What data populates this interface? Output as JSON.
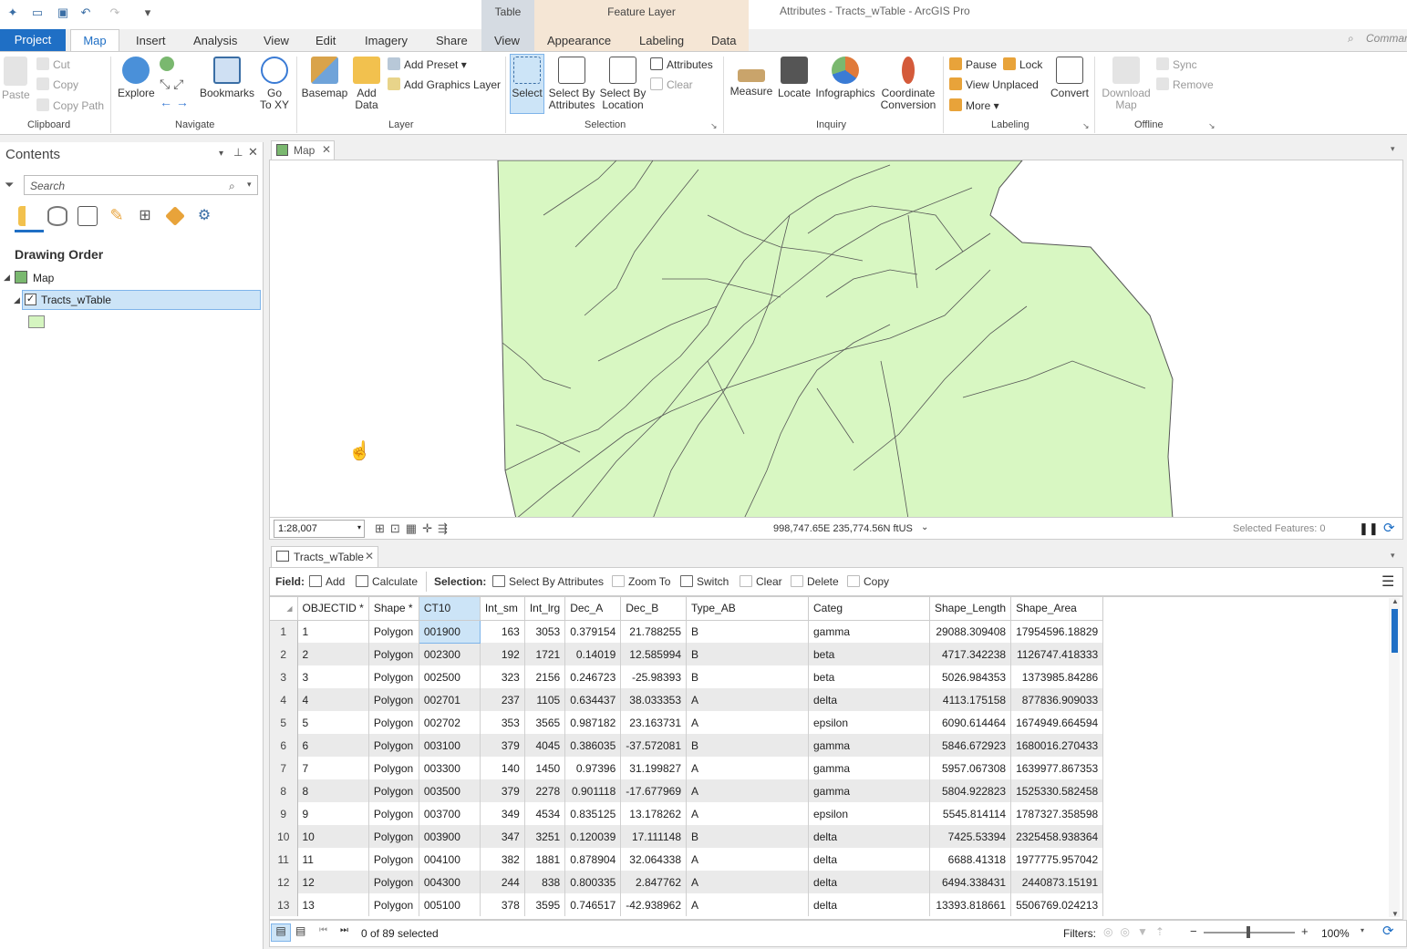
{
  "app": {
    "title": "Attributes - Tracts_wTable - ArcGIS Pro",
    "context_tabs": {
      "table": "Table",
      "feature_layer": "Feature Layer"
    },
    "command_search": "Command"
  },
  "tabs": [
    "Project",
    "Map",
    "Insert",
    "Analysis",
    "View",
    "Edit",
    "Imagery",
    "Share",
    "View",
    "Appearance",
    "Labeling",
    "Data"
  ],
  "ribbon": {
    "clipboard": {
      "label": "Clipboard",
      "paste": "Paste",
      "cut": "Cut",
      "copy": "Copy",
      "copy_path": "Copy Path"
    },
    "navigate": {
      "label": "Navigate",
      "explore": "Explore",
      "bookmarks": "Bookmarks",
      "goto_1": "Go",
      "goto_2": "To XY"
    },
    "layer": {
      "label": "Layer",
      "basemap": "Basemap",
      "add_data_1": "Add",
      "add_data_2": "Data",
      "add_preset": "Add Preset",
      "add_graphics": "Add Graphics Layer"
    },
    "selection": {
      "label": "Selection",
      "select": "Select",
      "sba_1": "Select By",
      "sba_2": "Attributes",
      "sbl_1": "Select By",
      "sbl_2": "Location",
      "attributes": "Attributes",
      "clear": "Clear"
    },
    "inquiry": {
      "label": "Inquiry",
      "measure": "Measure",
      "locate": "Locate",
      "infographics": "Infographics",
      "cc_1": "Coordinate",
      "cc_2": "Conversion"
    },
    "labeling": {
      "label": "Labeling",
      "pause": "Pause",
      "lock": "Lock",
      "view_unplaced": "View Unplaced",
      "more": "More",
      "convert": "Convert"
    },
    "offline": {
      "label": "Offline",
      "download_1": "Download",
      "download_2": "Map",
      "sync": "Sync",
      "remove": "Remove"
    }
  },
  "contents": {
    "title": "Contents",
    "search_placeholder": "Search",
    "drawing_order": "Drawing Order",
    "map_node": "Map",
    "layer_node": "Tracts_wTable"
  },
  "map": {
    "tab": "Map",
    "scale": "1:28,007",
    "coords": "998,747.65E 235,774.56N ftUS",
    "selected_features": "Selected Features: 0",
    "fill_color": "#d8f7c2"
  },
  "table": {
    "tab": "Tracts_wTable",
    "toolbar": {
      "field_label": "Field:",
      "add": "Add",
      "calculate": "Calculate",
      "selection_label": "Selection:",
      "select_by_attributes": "Select By Attributes",
      "zoom_to": "Zoom To",
      "switch": "Switch",
      "clear": "Clear",
      "delete": "Delete",
      "copy": "Copy"
    },
    "columns": [
      "OBJECTID *",
      "Shape *",
      "CT10",
      "Int_sm",
      "Int_lrg",
      "Dec_A",
      "Dec_B",
      "Type_AB",
      "Categ",
      "Shape_Length",
      "Shape_Area"
    ],
    "rows": [
      [
        "1",
        "1",
        "Polygon",
        "001900",
        "163",
        "3053",
        "0.379154",
        "21.788255",
        "B",
        "gamma",
        "29088.309408",
        "17954596.18829"
      ],
      [
        "2",
        "2",
        "Polygon",
        "002300",
        "192",
        "1721",
        "0.14019",
        "12.585994",
        "B",
        "beta",
        "4717.342238",
        "1126747.418333"
      ],
      [
        "3",
        "3",
        "Polygon",
        "002500",
        "323",
        "2156",
        "0.246723",
        "-25.98393",
        "B",
        "beta",
        "5026.984353",
        "1373985.84286"
      ],
      [
        "4",
        "4",
        "Polygon",
        "002701",
        "237",
        "1105",
        "0.634437",
        "38.033353",
        "A",
        "delta",
        "4113.175158",
        "877836.909033"
      ],
      [
        "5",
        "5",
        "Polygon",
        "002702",
        "353",
        "3565",
        "0.987182",
        "23.163731",
        "A",
        "epsilon",
        "6090.614464",
        "1674949.664594"
      ],
      [
        "6",
        "6",
        "Polygon",
        "003100",
        "379",
        "4045",
        "0.386035",
        "-37.572081",
        "B",
        "gamma",
        "5846.672923",
        "1680016.270433"
      ],
      [
        "7",
        "7",
        "Polygon",
        "003300",
        "140",
        "1450",
        "0.97396",
        "31.199827",
        "A",
        "gamma",
        "5957.067308",
        "1639977.867353"
      ],
      [
        "8",
        "8",
        "Polygon",
        "003500",
        "379",
        "2278",
        "0.901118",
        "-17.677969",
        "A",
        "gamma",
        "5804.922823",
        "1525330.582458"
      ],
      [
        "9",
        "9",
        "Polygon",
        "003700",
        "349",
        "4534",
        "0.835125",
        "13.178262",
        "A",
        "epsilon",
        "5545.814114",
        "1787327.358598"
      ],
      [
        "10",
        "10",
        "Polygon",
        "003900",
        "347",
        "3251",
        "0.120039",
        "17.111148",
        "B",
        "delta",
        "7425.53394",
        "2325458.938364"
      ],
      [
        "11",
        "11",
        "Polygon",
        "004100",
        "382",
        "1881",
        "0.878904",
        "32.064338",
        "A",
        "delta",
        "6688.41318",
        "1977775.957042"
      ],
      [
        "12",
        "12",
        "Polygon",
        "004300",
        "244",
        "838",
        "0.800335",
        "2.847762",
        "A",
        "delta",
        "6494.338431",
        "2440873.15191"
      ],
      [
        "13",
        "13",
        "Polygon",
        "005100",
        "378",
        "3595",
        "0.746517",
        "-42.938962",
        "A",
        "delta",
        "13393.818661",
        "5506769.024213"
      ]
    ],
    "selected_count": "0 of 89 selected",
    "filters_label": "Filters:",
    "zoom": "100%"
  }
}
